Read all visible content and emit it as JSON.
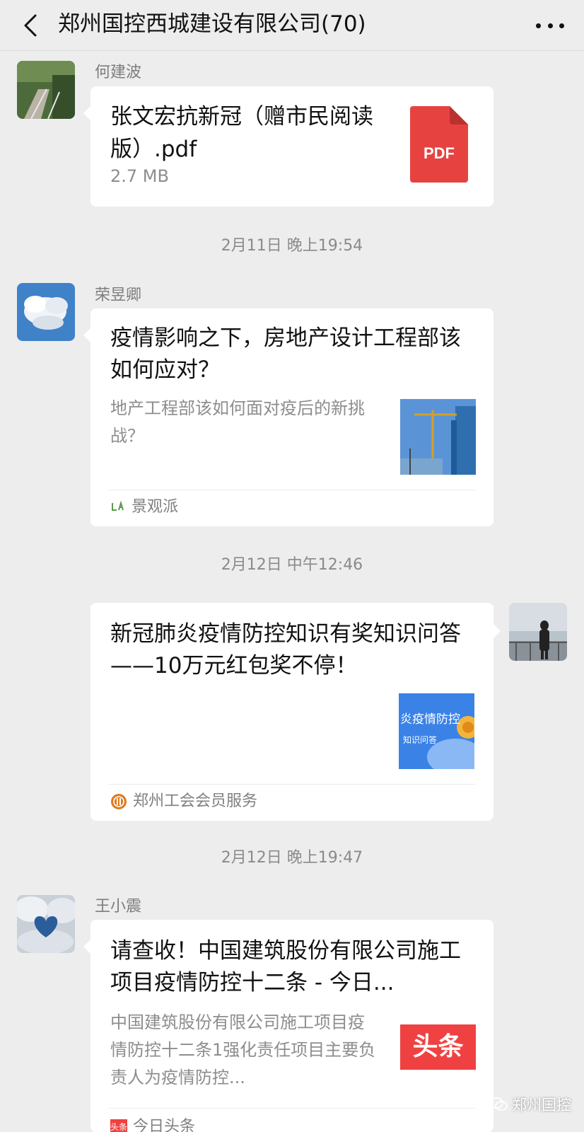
{
  "header": {
    "title": "郑州国控西城建设有限公司(70)"
  },
  "messages": [
    {
      "sender": "何建波",
      "type": "file",
      "file_name": "张文宏抗新冠（赠市民阅读版）.pdf",
      "file_size": "2.7 MB",
      "file_icon_label": "PDF"
    },
    {
      "time": "2月11日 晚上19:54"
    },
    {
      "sender": "荣昱卿",
      "type": "article",
      "title": "疫情影响之下，房地产设计工程部该如何应对？",
      "description": "地产工程部该如何面对疫后的新挑战？",
      "source": "景观派"
    },
    {
      "time": "2月12日 中午12:46"
    },
    {
      "sender": "",
      "type": "article",
      "title": "新冠肺炎疫情防控知识有奖知识问答——10万元红包奖不停！",
      "thumb_text_1": "炎疫情防控",
      "thumb_text_2": "知识问答",
      "source": "郑州工会会员服务"
    },
    {
      "time": "2月12日 晚上19:47"
    },
    {
      "sender": "王小震",
      "type": "article",
      "title": "请查收！中国建筑股份有限公司施工项目疫情防控十二条 - 今日...",
      "description": "中国建筑股份有限公司施工项目疫情防控十二条1强化责任项目主要负责人为疫情防控...",
      "thumb_text": "头条",
      "source_icon_text": "头条",
      "source": "今日头条"
    }
  ],
  "watermark": "郑州国控",
  "colors": {
    "background": "#ededed",
    "card": "#ffffff",
    "pdf_red": "#e64340",
    "toutiao_red": "#f04142",
    "muted_text": "#8d8d8d"
  }
}
